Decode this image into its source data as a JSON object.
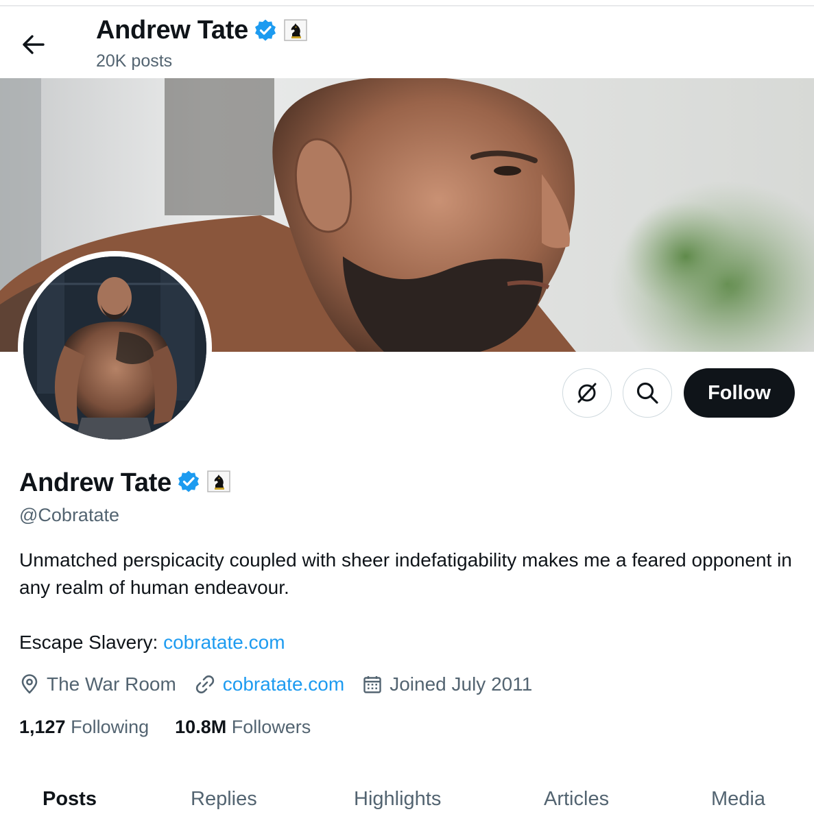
{
  "header": {
    "name": "Andrew Tate",
    "posts_count": "20K posts"
  },
  "actions": {
    "follow_label": "Follow"
  },
  "profile": {
    "name": "Andrew Tate",
    "handle": "@Cobratate",
    "bio": "Unmatched perspicacity coupled with sheer indefatigability makes me a feared opponent in any realm of human endeavour.",
    "bio_link_prefix": "Escape Slavery:",
    "bio_link": "cobratate.com",
    "location": "The War Room",
    "website": "cobratate.com",
    "joined": "Joined July 2011",
    "following_count": "1,127",
    "following_label": "Following",
    "followers_count": "10.8M",
    "followers_label": "Followers"
  },
  "tabs": [
    {
      "label": "Posts",
      "active": true
    },
    {
      "label": "Replies",
      "active": false
    },
    {
      "label": "Highlights",
      "active": false
    },
    {
      "label": "Articles",
      "active": false
    },
    {
      "label": "Media",
      "active": false
    }
  ],
  "colors": {
    "accent": "#1d9bf0",
    "text_primary": "#0f1419",
    "text_secondary": "#536471",
    "follow_bg": "#0f1419",
    "affiliate_badge": "#c9a227"
  },
  "icons": {
    "back": "arrow-left-icon",
    "verified": "verified-badge-icon",
    "affiliate": "chess-knight-icon",
    "grok": "grok-icon",
    "search": "search-icon",
    "location": "location-pin-icon",
    "link": "link-icon",
    "calendar": "calendar-icon"
  }
}
